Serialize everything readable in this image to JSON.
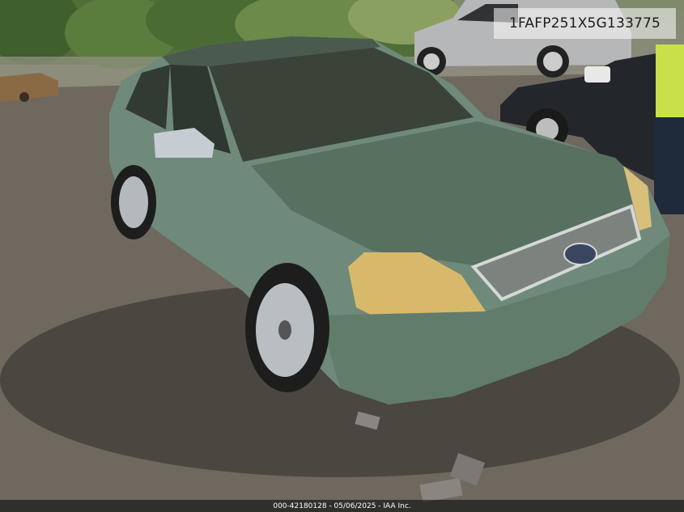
{
  "photo": {
    "vin_overlay": "1FAFP251X5G133775",
    "footer_caption": "000-42180128 - 05/06/2025 - IAA Inc."
  }
}
